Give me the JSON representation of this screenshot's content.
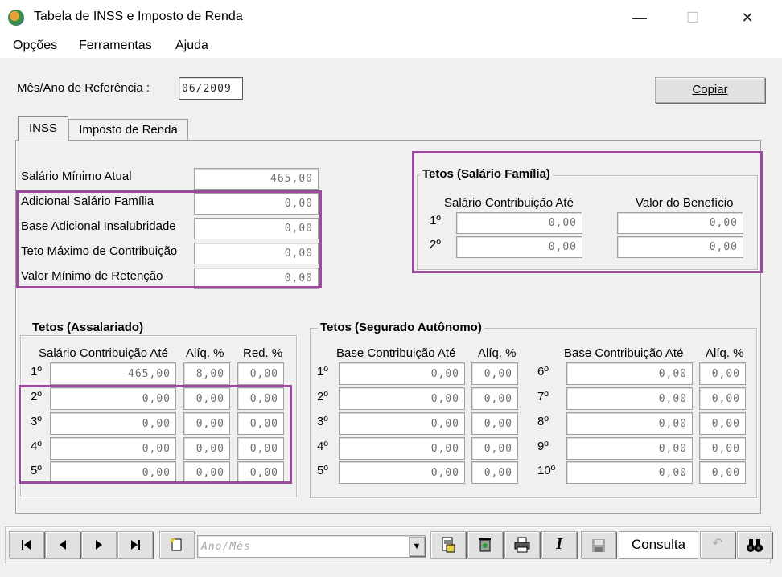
{
  "window": {
    "title": "Tabela de INSS e Imposto de Renda",
    "controls": {
      "minimize": "—",
      "maximize": "☐",
      "close": "✕"
    }
  },
  "menu": [
    "Opções",
    "Ferramentas",
    "Ajuda"
  ],
  "reference": {
    "label": "Mês/Ano de Referência :",
    "value": "06/2009"
  },
  "copy_button": "Copiar",
  "tabs": [
    {
      "label": "INSS",
      "active": true
    },
    {
      "label": "Imposto de Renda",
      "active": false
    }
  ],
  "inss_fields": [
    {
      "label": "Salário Mínimo Atual",
      "value": "465,00"
    },
    {
      "label": "Adicional Salário Família",
      "value": "0,00"
    },
    {
      "label": "Base Adicional Insalubridade",
      "value": "0,00"
    },
    {
      "label": "Teto Máximo de Contribuição",
      "value": "0,00"
    },
    {
      "label": "Valor Mínimo de Retenção",
      "value": "0,00"
    }
  ],
  "familia": {
    "title": "Tetos (Salário Família)",
    "col1": "Salário Contribuição Até",
    "col2": "Valor do Benefício",
    "rows": [
      {
        "n": "1º",
        "a": "0,00",
        "b": "0,00"
      },
      {
        "n": "2º",
        "a": "0,00",
        "b": "0,00"
      }
    ]
  },
  "assalariado": {
    "title": "Tetos (Assalariado)",
    "col1": "Salário Contribuição Até",
    "col2": "Alíq. %",
    "col3": "Red. %",
    "rows": [
      {
        "n": "1º",
        "a": "465,00",
        "b": "8,00",
        "c": "0,00"
      },
      {
        "n": "2º",
        "a": "0,00",
        "b": "0,00",
        "c": "0,00"
      },
      {
        "n": "3º",
        "a": "0,00",
        "b": "0,00",
        "c": "0,00"
      },
      {
        "n": "4º",
        "a": "0,00",
        "b": "0,00",
        "c": "0,00"
      },
      {
        "n": "5º",
        "a": "0,00",
        "b": "0,00",
        "c": "0,00"
      }
    ]
  },
  "autonomo": {
    "title": "Tetos (Segurado Autônomo)",
    "col1": "Base Contribuição Até",
    "col2": "Alíq. %",
    "left_rows": [
      {
        "n": "1º",
        "a": "0,00",
        "b": "0,00"
      },
      {
        "n": "2º",
        "a": "0,00",
        "b": "0,00"
      },
      {
        "n": "3º",
        "a": "0,00",
        "b": "0,00"
      },
      {
        "n": "4º",
        "a": "0,00",
        "b": "0,00"
      },
      {
        "n": "5º",
        "a": "0,00",
        "b": "0,00"
      }
    ],
    "right_rows": [
      {
        "n": "6º",
        "a": "0,00",
        "b": "0,00"
      },
      {
        "n": "7º",
        "a": "0,00",
        "b": "0,00"
      },
      {
        "n": "8º",
        "a": "0,00",
        "b": "0,00"
      },
      {
        "n": "9º",
        "a": "0,00",
        "b": "0,00"
      },
      {
        "n": "10º",
        "a": "0,00",
        "b": "0,00"
      }
    ]
  },
  "toolbar": {
    "period_placeholder": "Ano/Mês",
    "consulta": "Consulta",
    "highlight_color": "#9b4b9e"
  }
}
